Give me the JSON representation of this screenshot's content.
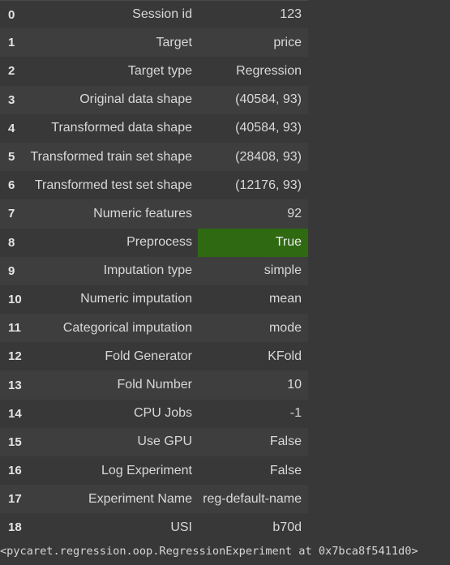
{
  "table": {
    "rows": [
      {
        "index": "0",
        "description": "Session id",
        "value": "123"
      },
      {
        "index": "1",
        "description": "Target",
        "value": "price"
      },
      {
        "index": "2",
        "description": "Target type",
        "value": "Regression"
      },
      {
        "index": "3",
        "description": "Original data shape",
        "value": "(40584, 93)"
      },
      {
        "index": "4",
        "description": "Transformed data shape",
        "value": "(40584, 93)"
      },
      {
        "index": "5",
        "description": "Transformed train set shape",
        "value": "(28408, 93)"
      },
      {
        "index": "6",
        "description": "Transformed test set shape",
        "value": "(12176, 93)"
      },
      {
        "index": "7",
        "description": "Numeric features",
        "value": "92"
      },
      {
        "index": "8",
        "description": "Preprocess",
        "value": "True"
      },
      {
        "index": "9",
        "description": "Imputation type",
        "value": "simple"
      },
      {
        "index": "10",
        "description": "Numeric imputation",
        "value": "mean"
      },
      {
        "index": "11",
        "description": "Categorical imputation",
        "value": "mode"
      },
      {
        "index": "12",
        "description": "Fold Generator",
        "value": "KFold"
      },
      {
        "index": "13",
        "description": "Fold Number",
        "value": "10"
      },
      {
        "index": "14",
        "description": "CPU Jobs",
        "value": "-1"
      },
      {
        "index": "15",
        "description": "Use GPU",
        "value": "False"
      },
      {
        "index": "16",
        "description": "Log Experiment",
        "value": "False"
      },
      {
        "index": "17",
        "description": "Experiment Name",
        "value": "reg-default-name"
      },
      {
        "index": "18",
        "description": "USI",
        "value": "b70d"
      }
    ]
  },
  "highlight_color": "#2f6a12",
  "output_repr": "<pycaret.regression.oop.RegressionExperiment at 0x7bca8f5411d0>"
}
